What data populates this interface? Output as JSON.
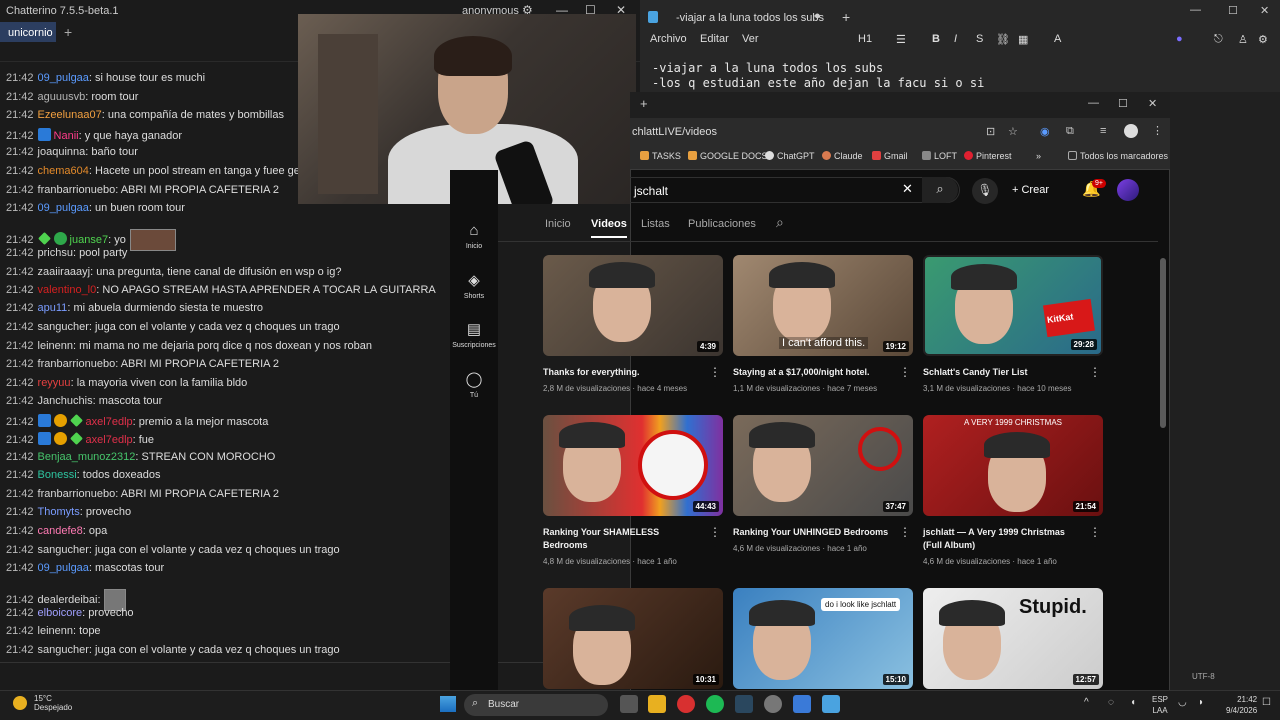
{
  "chatterino": {
    "window_title": "Chatterino 7.5.5-beta.1",
    "account": "anonymous",
    "tab": "unicornio",
    "channel": "unicornio",
    "messages": [
      {
        "time": "21:42",
        "user": "09_pulgaa",
        "color": "#5b9bff",
        "text": "si house tour es muchi"
      },
      {
        "time": "21:42",
        "user": "aguuusvb",
        "color": "#b4b4b4",
        "text": "room tour"
      },
      {
        "time": "21:42",
        "user": "Ezeelunaa07",
        "color": "#f2a040",
        "text": "una compañía de mates y bombillas"
      },
      {
        "time": "21:42",
        "user": "Nanii",
        "color": "#ff3c8a",
        "text": "y que haya ganador"
      },
      {
        "time": "21:42",
        "user": "joaquinna",
        "color": "#d8d8d8",
        "text": "baño tour"
      },
      {
        "time": "21:42",
        "user": "chema604",
        "color": "#e48a2a",
        "text": "Hacete un pool stream en tanga y fuee ger"
      },
      {
        "time": "21:42",
        "user": "franbarrionuebo",
        "color": "#d8d8d8",
        "text": "ABRI MI PROPIA CAFETERIA 2"
      },
      {
        "time": "21:42",
        "user": "09_pulgaa",
        "color": "#5b9bff",
        "text": "un buen room tour"
      },
      {
        "time": "21:42",
        "user": "juanse7",
        "color": "#4fd34f",
        "text": "yo"
      },
      {
        "time": "21:42",
        "user": "prichsu",
        "color": "#d8d8d8",
        "text": "pool party"
      },
      {
        "time": "21:42",
        "user": "zaaiiraaayj",
        "color": "#d8d8d8",
        "text": "una pregunta, tiene canal de difusión en wsp o ig?"
      },
      {
        "time": "21:42",
        "user": "valentino_l0",
        "color": "#d62020",
        "text": "NO APAGO STREAM HASTA APRENDER A TOCAR LA GUITARRA"
      },
      {
        "time": "21:42",
        "user": "apu11",
        "color": "#7a9cff",
        "text": "mi abuela durmiendo siesta te muestro"
      },
      {
        "time": "21:42",
        "user": "sangucher",
        "color": "#d8d8d8",
        "text": "juga con el volante y cada vez q choques un trago"
      },
      {
        "time": "21:42",
        "user": "leinenn",
        "color": "#d8d8d8",
        "text": "mi mama no me dejaria porq dice q nos doxean y nos roban"
      },
      {
        "time": "21:42",
        "user": "franbarrionuebo",
        "color": "#d8d8d8",
        "text": "ABRI MI PROPIA CAFETERIA 2"
      },
      {
        "time": "21:42",
        "user": "reyyuu",
        "color": "#e64040",
        "text": "la mayoria viven con la familia bldo"
      },
      {
        "time": "21:42",
        "user": "Janchuchis",
        "color": "#d8d8d8",
        "text": "mascota tour"
      },
      {
        "time": "21:42",
        "user": "axel7edlp",
        "color": "#e0304a",
        "text": "premio a la mejor mascota"
      },
      {
        "time": "21:42",
        "user": "axel7edlp",
        "color": "#e0304a",
        "text": "fue"
      },
      {
        "time": "21:42",
        "user": "Benjaa_munoz2312",
        "color": "#46c46b",
        "text": "STREAN CON MOROCHO"
      },
      {
        "time": "21:42",
        "user": "Bonessi",
        "color": "#2ec4a0",
        "text": "todos doxeados"
      },
      {
        "time": "21:42",
        "user": "franbarrionuebo",
        "color": "#d8d8d8",
        "text": "ABRI MI PROPIA CAFETERIA 2"
      },
      {
        "time": "21:42",
        "user": "Thomyts",
        "color": "#7a9cff",
        "text": "provecho"
      },
      {
        "time": "21:42",
        "user": "candefe8",
        "color": "#ff7ab4",
        "text": "opa"
      },
      {
        "time": "21:42",
        "user": "sangucher",
        "color": "#d8d8d8",
        "text": "juga con el volante y cada vez q choques un trago"
      },
      {
        "time": "21:42",
        "user": "09_pulgaa",
        "color": "#5b9bff",
        "text": "mascotas tour"
      },
      {
        "time": "21:42",
        "user": "dealerdeibai",
        "color": "#d8d8d8",
        "text": ""
      },
      {
        "time": "21:42",
        "user": "elboicore",
        "color": "#a0a0ff",
        "text": "provecho"
      },
      {
        "time": "21:42",
        "user": "leinenn",
        "color": "#d8d8d8",
        "text": "tope"
      },
      {
        "time": "21:42",
        "user": "sangucher",
        "color": "#d8d8d8",
        "text": "juga con el volante y cada vez q choques un trago"
      }
    ]
  },
  "notepad": {
    "tab_title": "-viajar a la luna todos los subs",
    "menu": [
      "Archivo",
      "Editar",
      "Ver"
    ],
    "heading": "H1",
    "lines": "-viajar a la luna todos los subs\n-los q estudian este año dejan la facu si o si"
  },
  "chrome": {
    "url": "chlattLIVE/videos",
    "bookmarks": [
      "TASKS",
      "GOOGLE DOCS",
      "ChatGPT",
      "Claude",
      "Gmail",
      "LOFT",
      "Pinterest",
      "Todos los marcadores"
    ]
  },
  "youtube": {
    "search_value": "jschalt",
    "create_label": "Crear",
    "notif_count": "9+",
    "nav": [
      {
        "icon": "⌂",
        "label": "Inicio"
      },
      {
        "icon": "◈",
        "label": "Shorts"
      },
      {
        "icon": "▤",
        "label": "Suscripciones"
      },
      {
        "icon": "◯",
        "label": "Tú"
      }
    ],
    "tabs": [
      "Inicio",
      "Videos",
      "Listas",
      "Publicaciones"
    ],
    "videos": [
      {
        "title": "Thanks for everything.",
        "meta": "2,8 M de visualizaciones · hace 4 meses",
        "duration": "4:39"
      },
      {
        "title": "Staying at a $17,000/night hotel.",
        "meta": "1,1 M de visualizaciones · hace 7 meses",
        "duration": "19:12",
        "caption": "I can't afford this."
      },
      {
        "title": "Schlatt's Candy Tier List",
        "meta": "3,1 M de visualizaciones · hace 10 meses",
        "duration": "29:28",
        "caption": "KitKat"
      },
      {
        "title": "Ranking Your SHAMELESS Bedrooms",
        "meta": "4,8 M de visualizaciones · hace 1 año",
        "duration": "44:43"
      },
      {
        "title": "Ranking Your UNHINGED Bedrooms",
        "meta": "4,6 M de visualizaciones · hace 1 año",
        "duration": "37:47"
      },
      {
        "title": "jschlatt — A Very 1999 Christmas (Full Album)",
        "meta": "4,6 M de visualizaciones · hace 1 año",
        "duration": "21:54",
        "caption": "A VERY 1999 CHRISTMAS"
      },
      {
        "title": "",
        "meta": "",
        "duration": "10:31"
      },
      {
        "title": "",
        "meta": "",
        "duration": "15:10",
        "caption": "do i look like jschlatt"
      },
      {
        "title": "",
        "meta": "",
        "duration": "12:57",
        "caption": "Stupid."
      }
    ]
  },
  "taskbar": {
    "weather_temp": "15°C",
    "weather_desc": "Despejado",
    "search": "Buscar",
    "lang1": "ESP",
    "lang2": "LAA",
    "time": "21:42",
    "date": "9/4/2026",
    "encoding": "UTF-8"
  }
}
